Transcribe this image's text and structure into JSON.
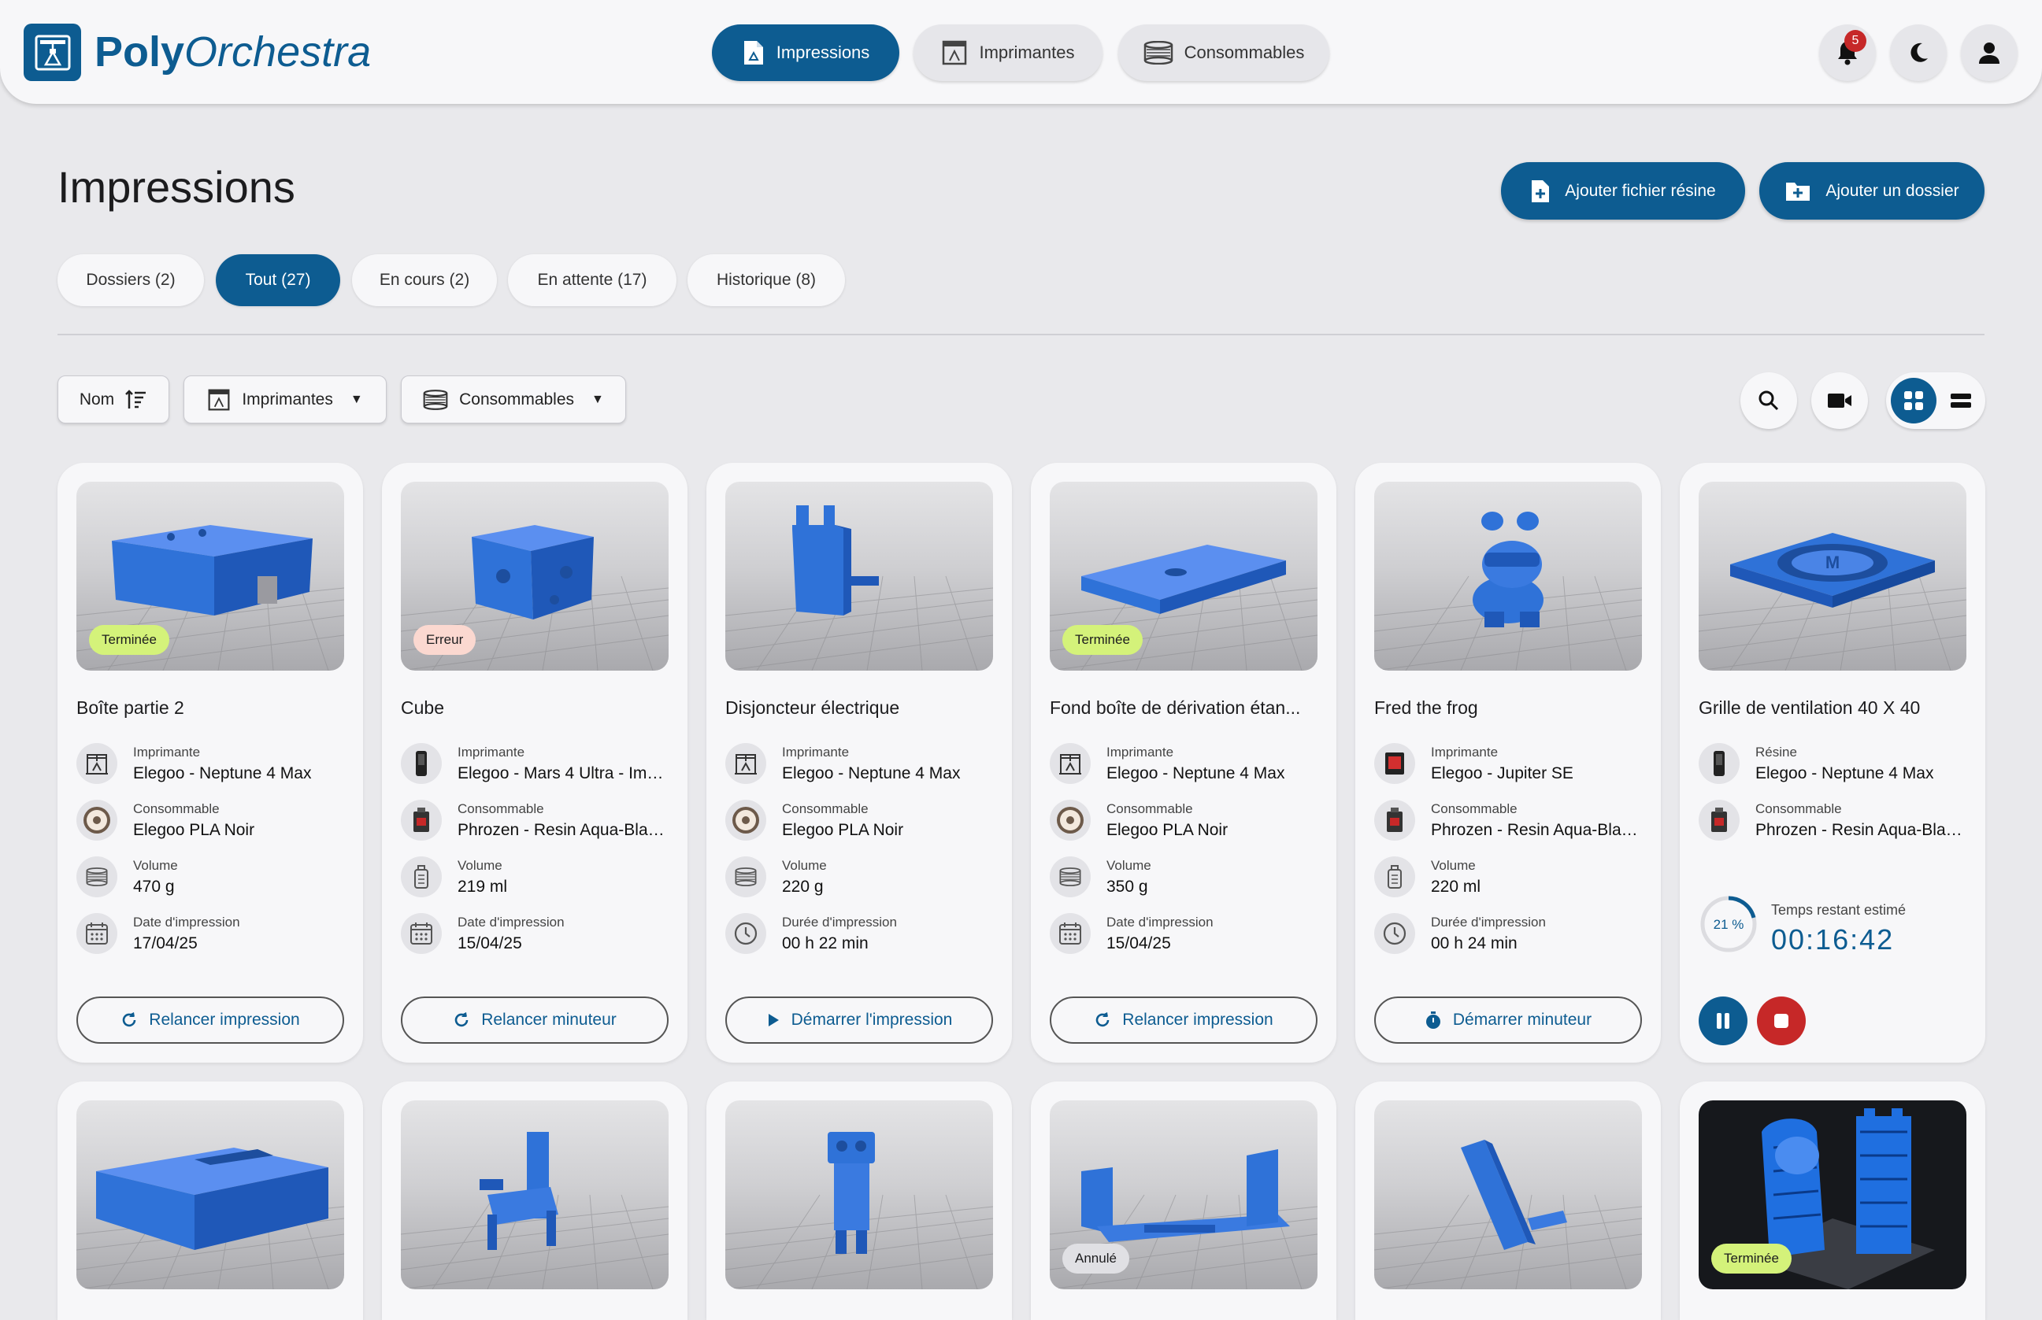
{
  "app": {
    "name_bold": "Poly",
    "name_rest": "Orchestra"
  },
  "nav": {
    "tabs": [
      {
        "label": "Impressions",
        "icon": "file-print-icon",
        "active": true
      },
      {
        "label": "Imprimantes",
        "icon": "printer-icon",
        "active": false
      },
      {
        "label": "Consommables",
        "icon": "spool-icon",
        "active": false
      }
    ],
    "notifications_count": "5"
  },
  "page": {
    "title": "Impressions",
    "add_resin_label": "Ajouter fichier résine",
    "add_folder_label": "Ajouter un dossier"
  },
  "tabs": [
    {
      "label": "Dossiers (2)",
      "active": false
    },
    {
      "label": "Tout (27)",
      "active": true
    },
    {
      "label": "En cours (2)",
      "active": false
    },
    {
      "label": "En attente (17)",
      "active": false
    },
    {
      "label": "Historique (8)",
      "active": false
    }
  ],
  "filters": {
    "sort_label": "Nom",
    "printers_label": "Imprimantes",
    "consumables_label": "Consommables"
  },
  "colors": {
    "primary": "#0d5c91",
    "model_blue": "#2f72d8",
    "status_done": "#d4f27a",
    "status_error": "#fbd8d0",
    "status_cancelled": "#e0e0e4",
    "stop_red": "#c62828"
  },
  "cards": [
    {
      "title": "Boîte partie 2",
      "status": "Terminée",
      "rows": [
        {
          "label": "Imprimante",
          "value": "Elegoo - Neptune 4 Max",
          "icon": "fdm-printer-icon"
        },
        {
          "label": "Consommable",
          "value": "Elegoo PLA Noir",
          "icon": "filament-spool-icon"
        },
        {
          "label": "Volume",
          "value": "470 g",
          "icon": "stack-icon"
        },
        {
          "label": "Date d'impression",
          "value": "17/04/25",
          "icon": "calendar-icon"
        }
      ],
      "action": "Relancer impression",
      "action_icon": "refresh-icon"
    },
    {
      "title": "Cube",
      "status": "Erreur",
      "rows": [
        {
          "label": "Imprimante",
          "value": "Elegoo - Mars 4 Ultra - Imp...",
          "icon": "resin-printer-icon"
        },
        {
          "label": "Consommable",
          "value": "Phrozen - Resin Aqua-Blac...",
          "icon": "resin-bottle-icon"
        },
        {
          "label": "Volume",
          "value": "219 ml",
          "icon": "bottle-icon"
        },
        {
          "label": "Date d'impression",
          "value": "15/04/25",
          "icon": "calendar-icon"
        }
      ],
      "action": "Relancer minuteur",
      "action_icon": "refresh-icon"
    },
    {
      "title": "Disjoncteur électrique",
      "status": "",
      "rows": [
        {
          "label": "Imprimante",
          "value": "Elegoo - Neptune 4 Max",
          "icon": "fdm-printer-icon"
        },
        {
          "label": "Consommable",
          "value": "Elegoo PLA Noir",
          "icon": "filament-spool-icon"
        },
        {
          "label": "Volume",
          "value": "220 g",
          "icon": "stack-icon"
        },
        {
          "label": "Durée d'impression",
          "value": "00 h 22 min",
          "icon": "clock-icon"
        }
      ],
      "action": "Démarrer l'impression",
      "action_icon": "play-icon"
    },
    {
      "title": "Fond boîte de dérivation étan...",
      "status": "Terminée",
      "rows": [
        {
          "label": "Imprimante",
          "value": "Elegoo - Neptune 4 Max",
          "icon": "fdm-printer-icon"
        },
        {
          "label": "Consommable",
          "value": "Elegoo PLA Noir",
          "icon": "filament-spool-icon"
        },
        {
          "label": "Volume",
          "value": "350 g",
          "icon": "stack-icon"
        },
        {
          "label": "Date d'impression",
          "value": "15/04/25",
          "icon": "calendar-icon"
        }
      ],
      "action": "Relancer impression",
      "action_icon": "refresh-icon"
    },
    {
      "title": "Fred the frog",
      "status": "",
      "rows": [
        {
          "label": "Imprimante",
          "value": "Elegoo - Jupiter SE",
          "icon": "resin-printer-red-icon"
        },
        {
          "label": "Consommable",
          "value": "Phrozen - Resin Aqua-Blac...",
          "icon": "resin-bottle-icon"
        },
        {
          "label": "Volume",
          "value": "220 ml",
          "icon": "bottle-icon"
        },
        {
          "label": "Durée d'impression",
          "value": "00 h 24 min",
          "icon": "clock-icon"
        }
      ],
      "action": "Démarrer minuteur",
      "action_icon": "stopwatch-icon"
    },
    {
      "title": "Grille de ventilation 40 X 40",
      "status": "",
      "rows": [
        {
          "label": "Résine",
          "value": "Elegoo - Neptune 4 Max",
          "icon": "resin-printer-icon"
        },
        {
          "label": "Consommable",
          "value": "Phrozen - Resin Aqua-Blac...",
          "icon": "resin-bottle-icon"
        }
      ],
      "timer": {
        "label": "Temps restant estimé",
        "value": "00:16:42",
        "percent": "21 %",
        "progress": 0.21
      }
    }
  ],
  "cards_row2": [
    {
      "status": ""
    },
    {
      "status": ""
    },
    {
      "status": ""
    },
    {
      "status": "Annulé"
    },
    {
      "status": ""
    },
    {
      "status": "Terminée"
    }
  ]
}
